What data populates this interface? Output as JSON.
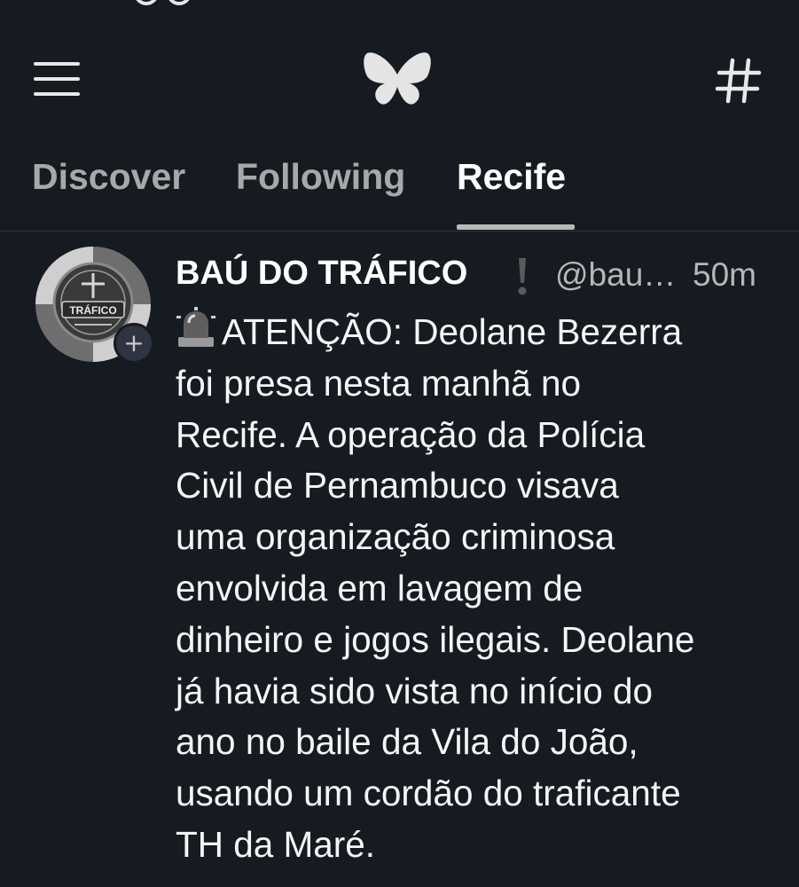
{
  "topbar": {
    "menu_icon": "hamburger-menu-icon",
    "logo_icon": "butterfly-logo-icon",
    "feeds_icon": "hashtag-icon"
  },
  "tabs": [
    {
      "label": "Discover",
      "active": false
    },
    {
      "label": "Following",
      "active": false
    },
    {
      "label": "Recife",
      "active": true
    }
  ],
  "post": {
    "author_name": "BAÚ DO TRÁFICO",
    "author_badge_icon": "exclamation-mark-icon",
    "handle": "@bau…",
    "timestamp": "50m",
    "avatar_text": "TRÁFICO",
    "lead_icon": "police-siren-icon",
    "text_lines": [
      "ATENÇÃO: Deolane Bezerra",
      "foi presa nesta manhã no",
      "Recife. A operação da Polícia",
      "Civil de Pernambuco visava",
      "uma organização criminosa",
      "envolvida em lavagem de",
      "dinheiro e jogos ilegais. Deolane",
      "já havia sido vista no início do",
      "ano no baile da Vila do João,",
      "usando um cordão do traficante",
      "TH da Maré."
    ]
  },
  "colors": {
    "background": "#161b22",
    "text_primary": "#ffffff",
    "text_secondary": "#b6b6b6",
    "divider": "#2d333b"
  }
}
